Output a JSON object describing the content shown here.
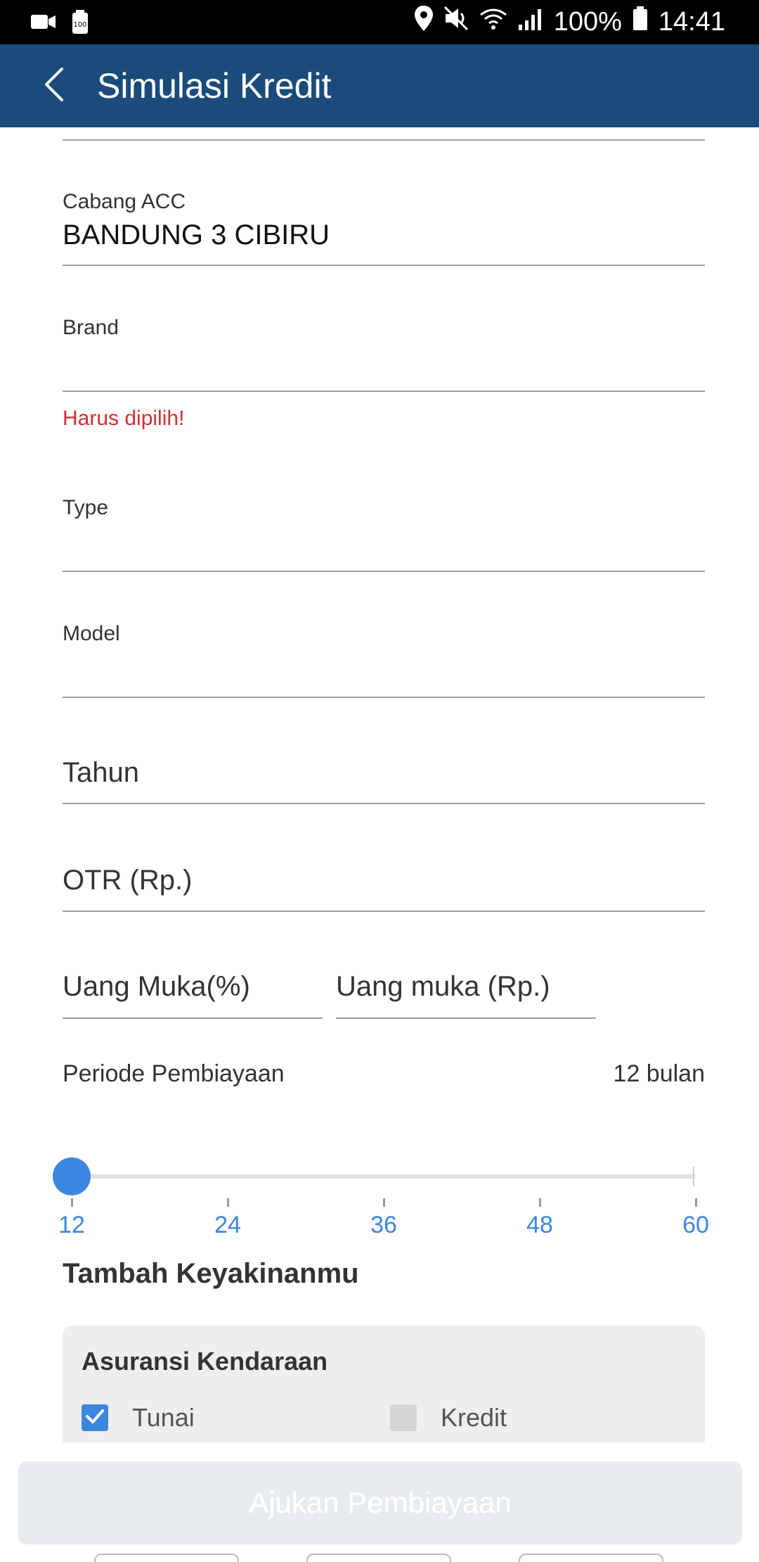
{
  "status_bar": {
    "battery_percent": "100%",
    "time": "14:41",
    "icons": [
      "video-camera-icon",
      "battery-saver-icon",
      "location-icon",
      "mute-icon",
      "wifi-icon",
      "signal-icon",
      "battery-icon"
    ]
  },
  "app_bar": {
    "back_icon": "chevron-left-icon",
    "title": "Simulasi Kredit"
  },
  "form": {
    "cabang": {
      "label": "Cabang ACC",
      "value": "BANDUNG 3 CIBIRU"
    },
    "brand": {
      "label": "Brand",
      "value": "",
      "error": "Harus dipilih!"
    },
    "type": {
      "label": "Type",
      "value": ""
    },
    "model": {
      "label": "Model",
      "value": ""
    },
    "tahun": {
      "placeholder": "Tahun"
    },
    "otr": {
      "placeholder": "OTR (Rp.)"
    },
    "uang_muka_percent": {
      "placeholder": "Uang Muka(%)"
    },
    "uang_muka_rp": {
      "placeholder": "Uang muka (Rp.)"
    },
    "periode": {
      "label": "Periode Pembiayaan",
      "value_text": "12 bulan",
      "slider_value": 12,
      "slider_min": 12,
      "slider_max": 60,
      "ticks": [
        "12",
        "24",
        "36",
        "48",
        "60"
      ]
    }
  },
  "extras": {
    "title": "Tambah Keyakinanmu",
    "asuransi": {
      "title": "Asuransi Kendaraan",
      "options": [
        {
          "label": "Tunai",
          "checked": true
        },
        {
          "label": "Kredit",
          "checked": false
        }
      ]
    }
  },
  "submit": {
    "label": "Ajukan Pembiayaan"
  },
  "colors": {
    "app_bar": "#1b4b7a",
    "accent": "#3d86e0",
    "error": "#d32f2f",
    "button_disabled": "#e9ecef"
  }
}
